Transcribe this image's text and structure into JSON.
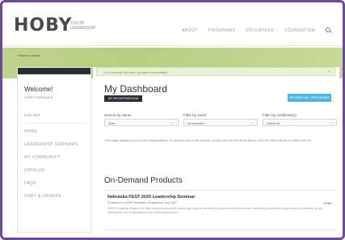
{
  "nav": {
    "logo": "HOBY",
    "tagline": "YOUTH LEADERSHIP",
    "links": [
      "ABOUT",
      "PROGRAMS",
      "VOLUNTEER",
      "FOUNDATION"
    ]
  },
  "band": {
    "breadcrumb": "« Back to Home"
  },
  "sidebar": {
    "welcome": "Welcome!",
    "username": "HOBY Participant",
    "logout": "LOG OUT",
    "items": [
      "HOME",
      "LEADERSHIP SEMINARS",
      "MY COMMUNITY",
      "CATALOG",
      "FAQS",
      "CART & ORDERS"
    ]
  },
  "main": {
    "alert": "Your account has been updated successfully.",
    "alert_close": "×",
    "title": "My Dashboard",
    "badge": "MY REGISTRATIONS",
    "button": "BROWSE ALL PROGRAMS",
    "filters": [
      {
        "label": "Search by Name",
        "value": "Start"
      },
      {
        "label": "Filter by event",
        "value": "All selected"
      },
      {
        "label": "Filter by certificate(s)",
        "value": "Select all"
      }
    ],
    "info": "This page displays your current registrations. To access any of the content, simply click on the items below. Use the filters above to refine this list.",
    "on_demand_title": "On-Demand Products",
    "product": {
      "name": "Nebraska FEST 2020 Leadership Seminar",
      "meta": "Produced by HOBY Nebraska   •   Registered: Sep 2020",
      "price": "FREE",
      "description": "HOBY's flagship program for high school sophomores that brings together students to explore and discover their leadership potential through hands-on activities, group discussions and presentations from community leaders."
    }
  }
}
